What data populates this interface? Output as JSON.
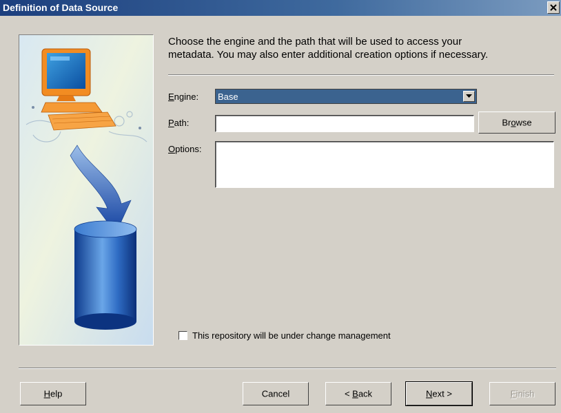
{
  "window": {
    "title": "Definition of Data Source",
    "close_icon": "close-icon"
  },
  "illustration": {
    "description_icon": "computer-to-database-icon",
    "colors": {
      "monitor": "#f08a20",
      "arrow": "#1a4aa8",
      "cylinder": "#1f5bb0"
    }
  },
  "intro": {
    "line1": "Choose the engine and the path that will be used to access your",
    "line2": "metadata. You may also enter additional creation options if necessary."
  },
  "form": {
    "engine": {
      "label_mnemonic": "E",
      "label_rest": "ngine:",
      "value": "Base"
    },
    "path": {
      "label_mnemonic": "P",
      "label_rest": "ath:",
      "value": ""
    },
    "browse": {
      "pre": "Br",
      "mnemonic": "o",
      "post": "wse"
    },
    "options": {
      "label_mnemonic": "O",
      "label_rest": "ptions:",
      "value": ""
    }
  },
  "change_management": {
    "checked": false,
    "label": "This repository will be under change management"
  },
  "footer": {
    "help": {
      "mnemonic": "H",
      "rest": "elp"
    },
    "cancel": "Cancel",
    "back": {
      "pre": "< ",
      "mnemonic": "B",
      "rest": "ack"
    },
    "next": {
      "mnemonic": "N",
      "rest": "ext >"
    },
    "finish": {
      "mnemonic": "F",
      "rest": "inish"
    }
  },
  "colors": {
    "titlebar": "#1c3f7e",
    "selection": "#3b638f",
    "face": "#d4d0c8"
  }
}
